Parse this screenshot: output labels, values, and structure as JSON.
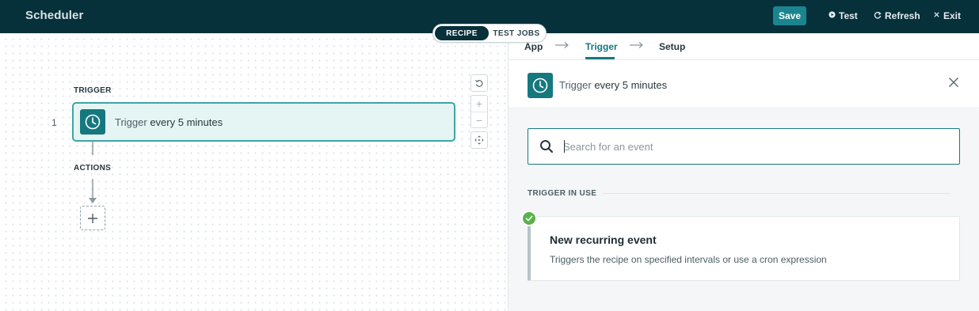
{
  "app": {
    "title": "Scheduler"
  },
  "topbar": {
    "save_label": "Save",
    "test_label": "Test",
    "refresh_label": "Refresh",
    "exit_label": "Exit"
  },
  "mode_toggle": {
    "recipe": "RECIPE",
    "test_jobs": "TEST JOBS",
    "selected": "RECIPE"
  },
  "canvas": {
    "trigger_section": "TRIGGER",
    "actions_section": "ACTIONS",
    "step_number": "1",
    "trigger_step": {
      "prefix": "Trigger",
      "text": "every 5 minutes"
    }
  },
  "breadcrumb": {
    "items": [
      {
        "label": "App"
      },
      {
        "label": "Trigger"
      },
      {
        "label": "Setup"
      }
    ],
    "active": "Trigger"
  },
  "panel": {
    "title_prefix": "Trigger",
    "title_text": "every 5 minutes",
    "search_placeholder": "Search for an event",
    "search_value": "",
    "in_use_label": "TRIGGER IN USE",
    "event": {
      "title": "New recurring event",
      "description": "Triggers the recipe on specified intervals or use a cron expression"
    }
  },
  "colors": {
    "topbar_bg": "#06303a",
    "accent": "#16787f",
    "save_bg": "#1a858f",
    "trigger_card_bg": "#e5f5f4",
    "trigger_card_border": "#3fa5a5",
    "success": "#59b24a"
  },
  "icons": [
    "test-icon",
    "refresh-icon",
    "exit-icon",
    "clock-icon",
    "undo-icon",
    "zoom-in-icon",
    "zoom-out-icon",
    "fit-view-icon",
    "plus-icon",
    "close-icon",
    "search-icon",
    "check-icon",
    "arrow-right-icon"
  ]
}
